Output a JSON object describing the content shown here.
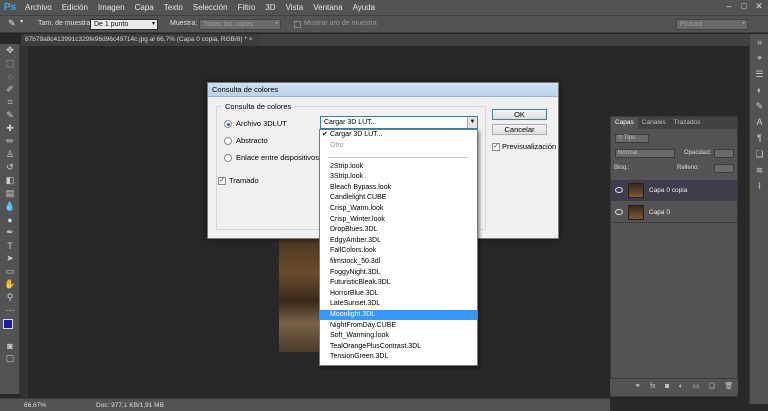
{
  "app": {
    "logo": "Ps"
  },
  "menu": [
    "Archivo",
    "Edición",
    "Imagen",
    "Capa",
    "Texto",
    "Selección",
    "Filtro",
    "3D",
    "Vista",
    "Ventana",
    "Ayuda"
  ],
  "window_controls": [
    "–",
    "□",
    "✕"
  ],
  "options_bar": {
    "sample_size_label": "Tam. de muestra:",
    "sample_size_value": "De 1 punto",
    "sample_label": "Muestra:",
    "sample_value": "Todas las capas",
    "show_ring_label": "Mostrar aro de muestra",
    "workspace_value": "Pintura"
  },
  "document": {
    "tab_title": "87b79a8c413991c329fe96d96c49714c.jpg al 66,7% (Capa 0 copia, RGB/8) *",
    "tab_close": "×"
  },
  "status": {
    "zoom": "66,67%",
    "doc_info": "Doc: 977,1 KB/1,91 MB"
  },
  "dialog": {
    "title": "Consulta de colores",
    "group_title": "Consulta de colores",
    "options": [
      {
        "label": "Archivo 3DLUT",
        "selected": true
      },
      {
        "label": "Abstracto",
        "selected": false
      },
      {
        "label": "Enlace entre dispositivos",
        "selected": false
      }
    ],
    "combo_value": "Cargar 3D LUT...",
    "dither_label": "Tramado",
    "dither_checked": true,
    "ok_label": "OK",
    "cancel_label": "Cancelar",
    "preview_label": "Previsualización",
    "preview_checked": true
  },
  "dropdown": {
    "checked_item": "Cargar 3D LUT...",
    "disabled_item": "Otro",
    "items": [
      "2Strip.look",
      "3Strip.look",
      "Bleach Bypass.look",
      "Candlelight.CUBE",
      "Crisp_Warm.look",
      "Crisp_Winter.look",
      "DropBlues.3DL",
      "EdgyAmber.3DL",
      "FallColors.look",
      "filmstock_50.3dl",
      "FoggyNight.3DL",
      "FuturisticBleak.3DL",
      "HorrorBlue.3DL",
      "LateSunset.3DL",
      "Moonlight.3DL",
      "NightFromDay.CUBE",
      "Soft_Warming.look",
      "TealOrangePlusContrast.3DL",
      "TensionGreen.3DL"
    ],
    "highlighted": "Moonlight.3DL"
  },
  "layers_panel": {
    "tabs": [
      "Capas",
      "Canales",
      "Trazados"
    ],
    "filter_label": "Tipo",
    "blend_mode": "Normal",
    "opacity_label": "Opacidad:",
    "lock_label": "Bloq.:",
    "fill_label": "Relleno:",
    "layers": [
      {
        "name": "Capa 0 copia",
        "selected": true
      },
      {
        "name": "Capa 0",
        "selected": false
      }
    ],
    "footer_icons": [
      "link-icon",
      "fx-icon",
      "mask-icon",
      "adjustment-icon",
      "group-icon",
      "new-layer-icon",
      "trash-icon"
    ],
    "footer_glyphs": [
      "⚭",
      "fx",
      "◙",
      "◐",
      "▭",
      "❏",
      "🗑"
    ]
  },
  "colors": {
    "chrome": "#535353",
    "canvas_bg": "#282828",
    "highlight": "#3399ff",
    "dialog_bg": "#f0f0f0"
  }
}
